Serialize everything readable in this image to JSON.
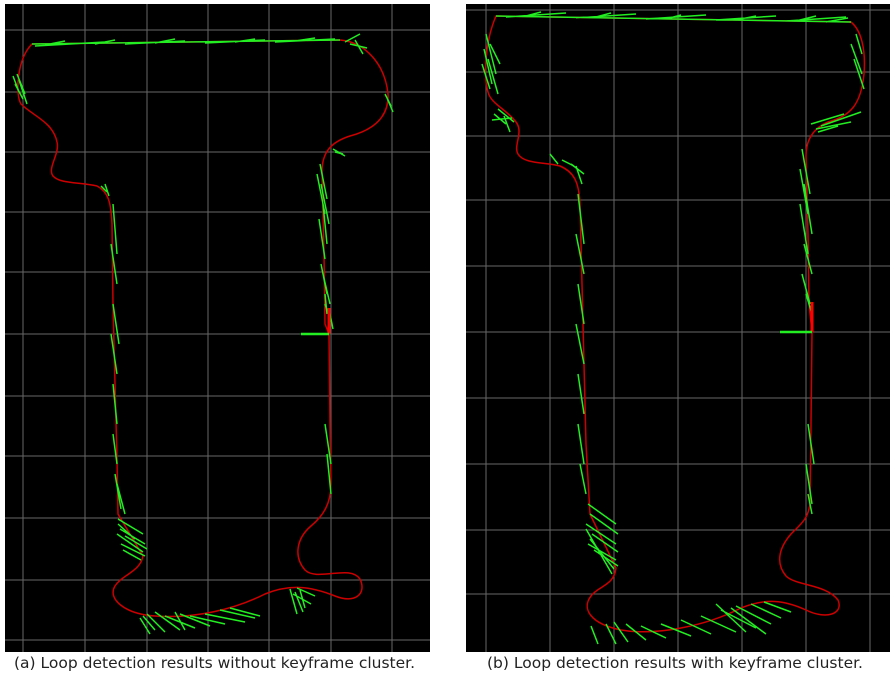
{
  "figure": {
    "panels": [
      {
        "id": "a",
        "caption": "(a) Loop detection results without keyframe cluster.",
        "colors": {
          "background": "#000000",
          "grid": "#8a8a8a",
          "trajectory": "#cc0000",
          "loop_lines": "#22ee22"
        }
      },
      {
        "id": "b",
        "caption": "(b) Loop detection results with keyframe cluster.",
        "colors": {
          "background": "#000000",
          "grid": "#8a8a8a",
          "trajectory": "#cc0000",
          "loop_lines": "#22ee22"
        }
      }
    ]
  }
}
